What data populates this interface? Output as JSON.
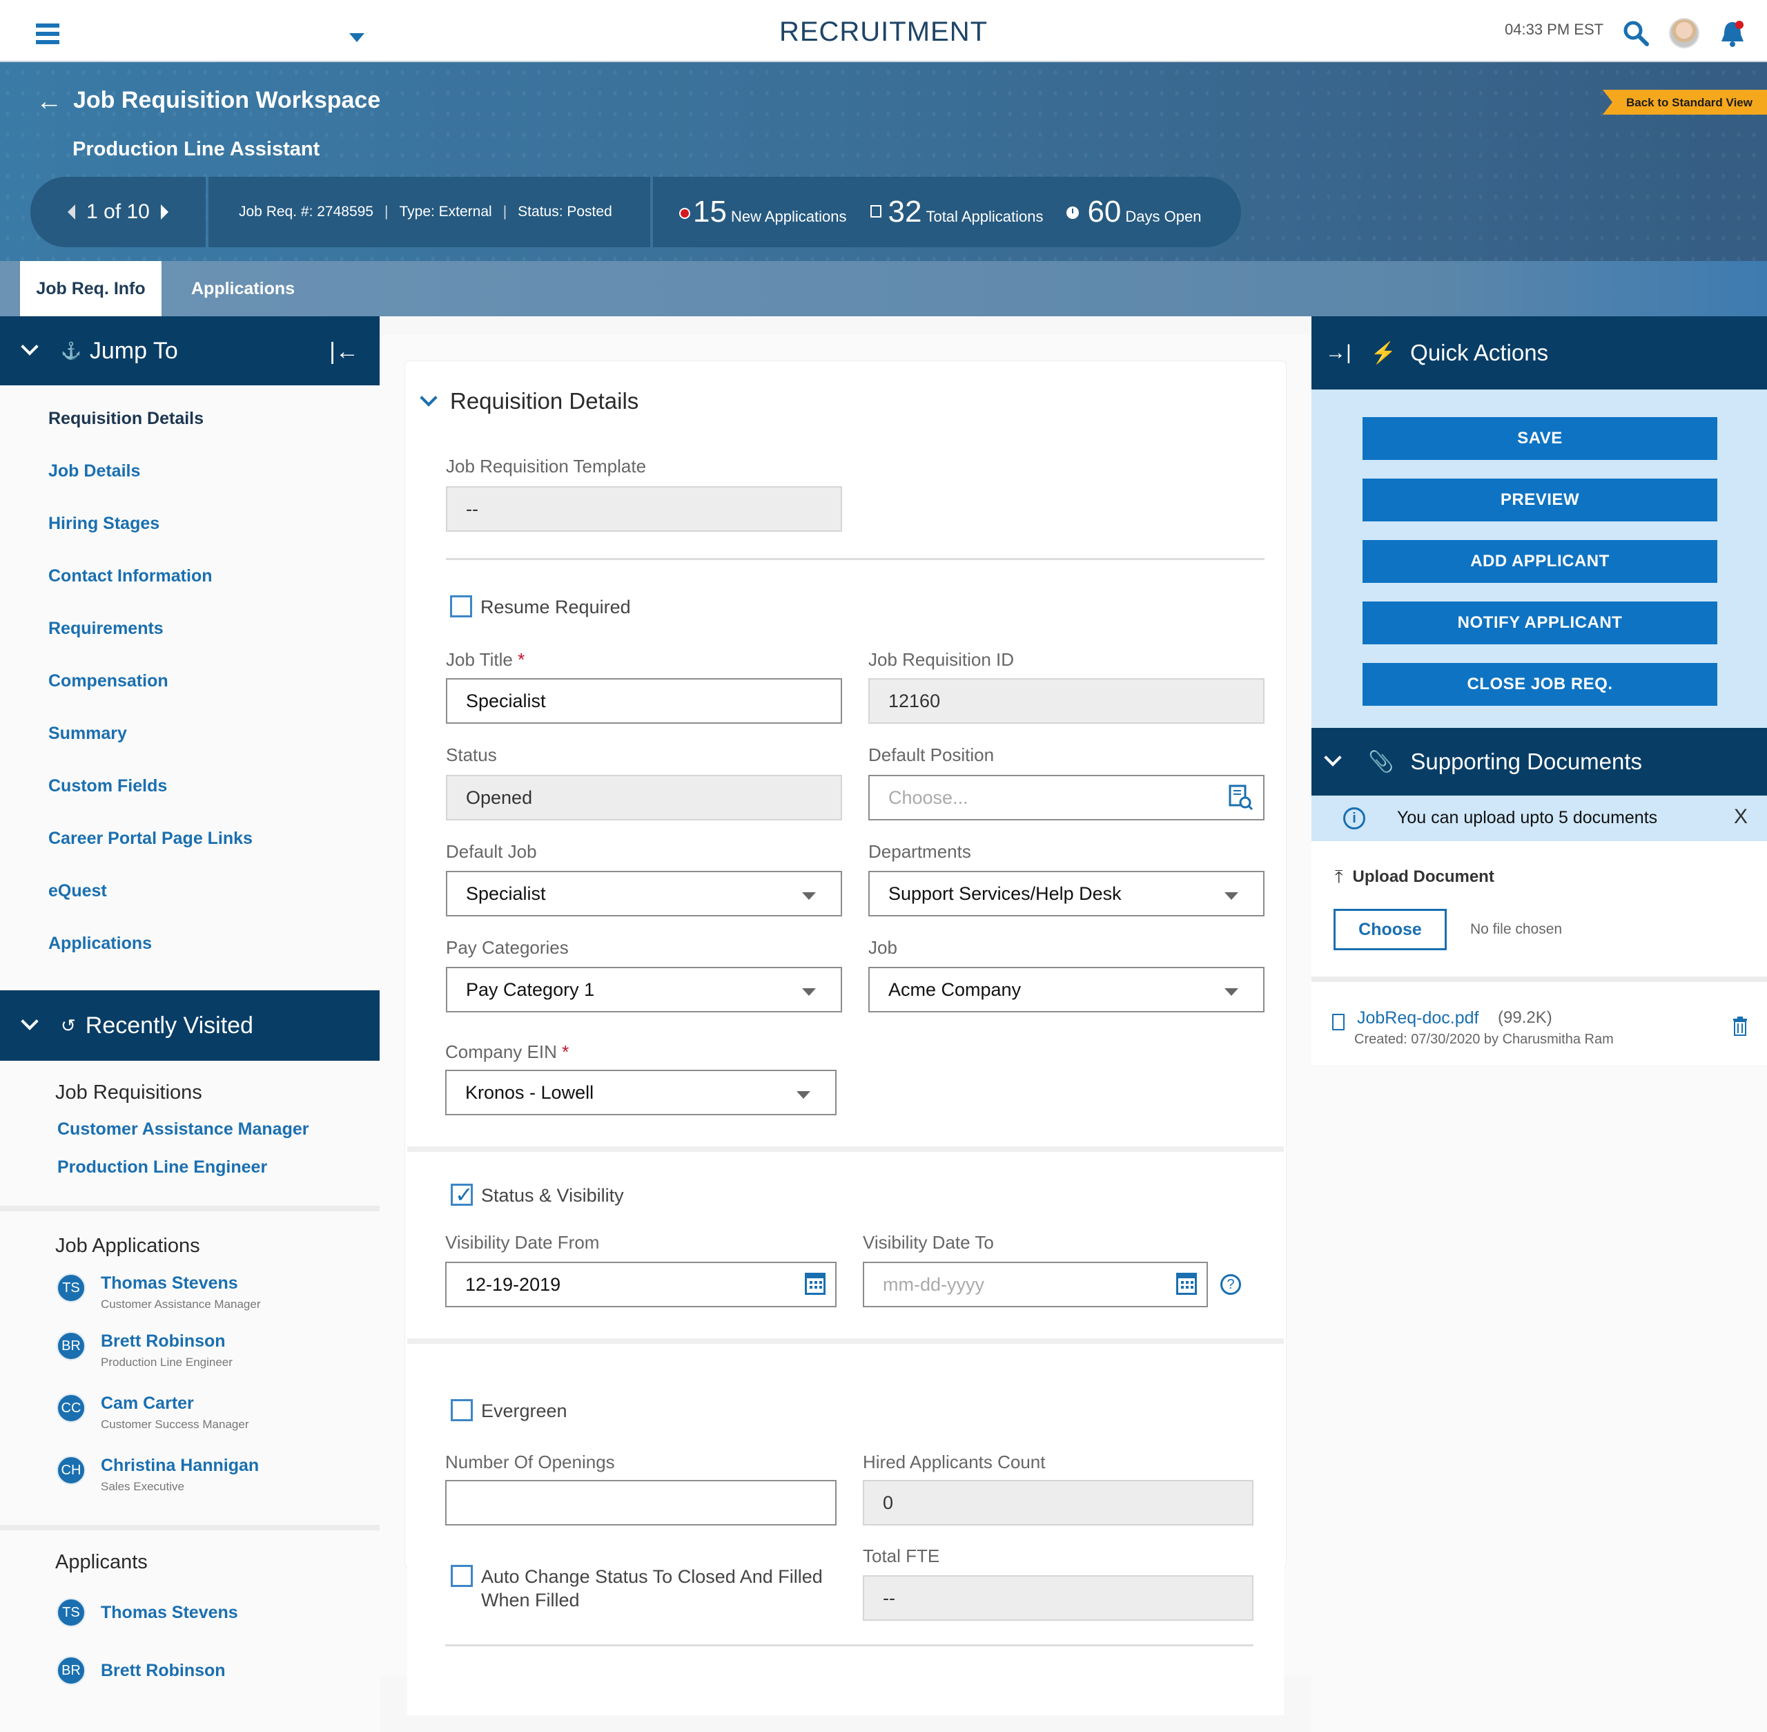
{
  "topbar": {
    "app_title": "RECRUITMENT",
    "clock": "04:33 PM EST",
    "icons": [
      "hamburger-menu-icon",
      "chevron-down-icon",
      "search-icon",
      "user-avatar",
      "bell-icon"
    ]
  },
  "header": {
    "workspace_title": "Job Requisition Workspace",
    "job_title": "Production Line Assistant",
    "back_to_standard": "Back to Standard View",
    "pager": "1 of 10",
    "job_req_number": "Job Req. #: 2748595",
    "type": "Type: External",
    "status": "Status: Posted",
    "separator": "|",
    "stats": [
      {
        "value": "15",
        "label": "New Applications",
        "icon": "new-dot-icon"
      },
      {
        "value": "32",
        "label": "Total Applications",
        "icon": "applications-icon"
      },
      {
        "value": "60",
        "label": "Days Open",
        "icon": "clock-icon"
      }
    ]
  },
  "tabs": [
    {
      "label": "Job Req. Info",
      "active": true
    },
    {
      "label": "Applications",
      "active": false
    }
  ],
  "sidebar": {
    "jump_to": {
      "title": "Jump To",
      "items": [
        {
          "label": "Requisition Details",
          "current": true
        },
        {
          "label": "Job Details"
        },
        {
          "label": "Hiring Stages"
        },
        {
          "label": "Contact Information"
        },
        {
          "label": "Requirements"
        },
        {
          "label": "Compensation"
        },
        {
          "label": "Summary"
        },
        {
          "label": "Custom Fields"
        },
        {
          "label": "Career Portal Page Links"
        },
        {
          "label": "eQuest"
        },
        {
          "label": "Applications"
        }
      ]
    },
    "recently_visited": {
      "title": "Recently Visited",
      "job_requisitions": {
        "title": "Job Requisitions",
        "items": [
          "Customer Assistance Manager",
          "Production Line Engineer"
        ]
      },
      "job_applications": {
        "title": "Job Applications",
        "items": [
          {
            "initials": "TS",
            "name": "Thomas Stevens",
            "role": "Customer Assistance Manager"
          },
          {
            "initials": "BR",
            "name": "Brett Robinson",
            "role": "Production Line Engineer"
          },
          {
            "initials": "CC",
            "name": "Cam Carter",
            "role": "Customer Success Manager"
          },
          {
            "initials": "CH",
            "name": "Christina Hannigan",
            "role": "Sales Executive"
          }
        ]
      },
      "applicants": {
        "title": "Applicants",
        "items": [
          {
            "initials": "TS",
            "name": "Thomas Stevens"
          },
          {
            "initials": "BR",
            "name": "Brett Robinson"
          }
        ]
      }
    }
  },
  "form": {
    "section_title": "Requisition Details",
    "job_req_template": {
      "label": "Job Requisition Template",
      "value": "--"
    },
    "resume_required": {
      "label": "Resume Required",
      "checked": false
    },
    "job_title": {
      "label": "Job Title",
      "required_mark": "*",
      "value": "Specialist"
    },
    "job_req_id": {
      "label": "Job Requisition ID",
      "value": "12160"
    },
    "status": {
      "label": "Status",
      "value": "Opened"
    },
    "default_position": {
      "label": "Default Position",
      "placeholder": "Choose..."
    },
    "default_job": {
      "label": "Default Job",
      "value": "Specialist"
    },
    "departments": {
      "label": "Departments",
      "value": "Support Services/Help Desk"
    },
    "pay_categories": {
      "label": "Pay Categories",
      "value": "Pay Category 1"
    },
    "job": {
      "label": "Job",
      "value": "Acme Company"
    },
    "company_ein": {
      "label": "Company EIN",
      "required_mark": "*",
      "value": "Kronos - Lowell"
    },
    "status_visibility": {
      "label": "Status & Visibility",
      "checked": true
    },
    "visibility_from": {
      "label": "Visibility Date From",
      "value": "12-19-2019"
    },
    "visibility_to": {
      "label": "Visibility Date To",
      "placeholder": "mm-dd-yyyy"
    },
    "help_glyph": "?",
    "evergreen": {
      "label": "Evergreen",
      "checked": false
    },
    "number_of_openings": {
      "label": "Number Of Openings",
      "value": ""
    },
    "hired_count": {
      "label": "Hired Applicants Count",
      "value": "0"
    },
    "auto_change": {
      "label": "Auto Change Status To Closed And Filled When Filled",
      "checked": false
    },
    "total_fte": {
      "label": "Total FTE",
      "value": "--"
    }
  },
  "quick_actions": {
    "title": "Quick Actions",
    "buttons": [
      "SAVE",
      "PREVIEW",
      "ADD APPLICANT",
      "NOTIFY APPLICANT",
      "CLOSE JOB REQ."
    ]
  },
  "supporting_documents": {
    "title": "Supporting Documents",
    "info": "You can upload upto 5 documents",
    "close_glyph": "X",
    "upload_label": "Upload Document",
    "choose_label": "Choose",
    "no_file": "No file chosen",
    "files": [
      {
        "name": "JobReq-doc.pdf",
        "size": "(99.2K)",
        "meta": "Created: 07/30/2020 by Charusmitha Ram"
      }
    ]
  },
  "colors": {
    "brand_blue": "#1a6fb0",
    "navy": "#083d66",
    "button_blue": "#0e73c3",
    "light_blue": "#cfe7f9",
    "ribbon": "#f6a81c",
    "required": "#c8102e"
  }
}
